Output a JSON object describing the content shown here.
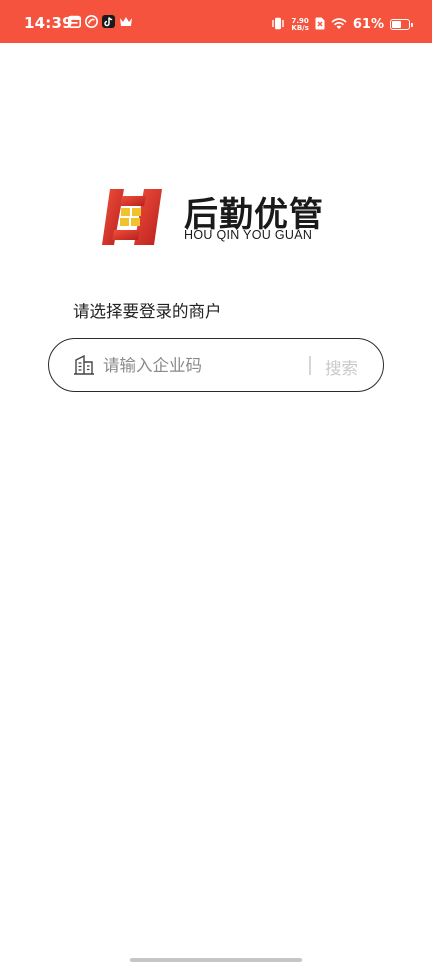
{
  "status_bar": {
    "time": "14:39",
    "net_speed_value": "7.90",
    "net_speed_unit": "KB/s",
    "battery_percent": "61%",
    "battery_level": 0.61,
    "background_color": "#f5533d",
    "notification_icons": [
      "calendar-icon",
      "shopee-icon",
      "tiktok-icon",
      "crown-icon"
    ],
    "system_icons": [
      "vibrate-icon",
      "sim-off-icon",
      "wifi-icon",
      "battery-icon"
    ]
  },
  "logo": {
    "chinese_name": "后勤优管",
    "english_name": "HOU QIN YOU GUAN",
    "mark_colors": [
      "#e03a2f",
      "#f2c12e"
    ]
  },
  "main": {
    "prompt": "请选择要登录的商户",
    "search": {
      "placeholder": "请输入企业码",
      "value": "",
      "button_label": "搜索",
      "icon": "building-icon"
    }
  }
}
